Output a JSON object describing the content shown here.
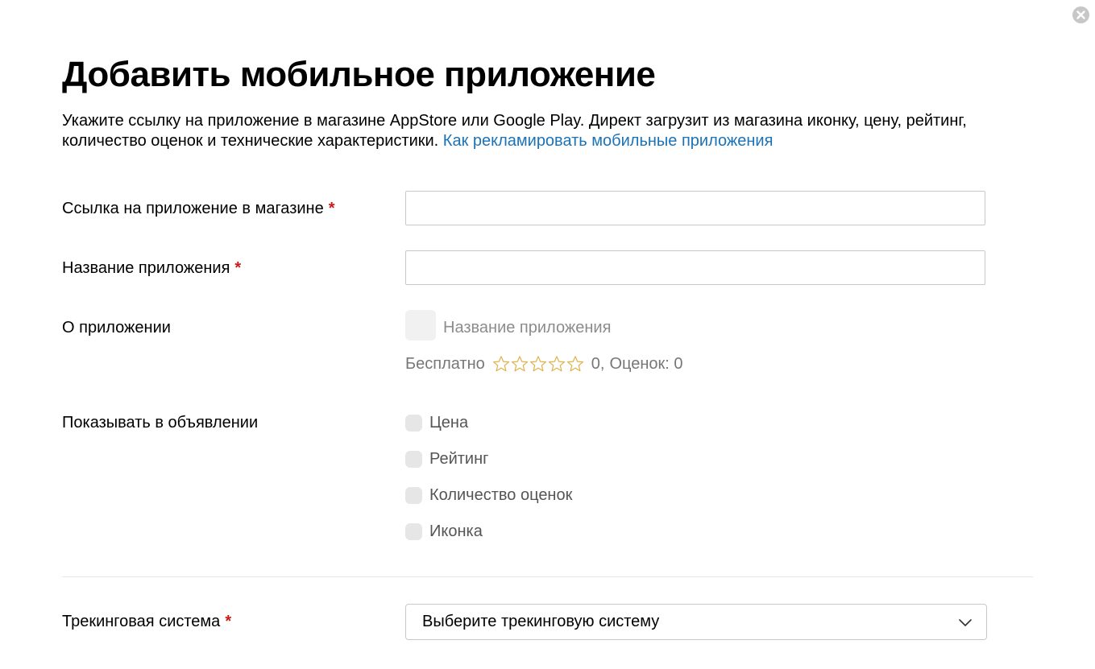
{
  "dialog": {
    "title": "Добавить мобильное приложение",
    "description": "Укажите ссылку на приложение в магазине AppStore или Google Play. Директ загрузит из магазина иконку, цену, рейтинг, количество оценок и технические характеристики. ",
    "help_link": "Как рекламировать мобильные приложения",
    "close_icon": "close-icon"
  },
  "form": {
    "store_link": {
      "label": "Ссылка на приложение в магазине",
      "required_mark": "*",
      "value": ""
    },
    "app_name": {
      "label": "Название приложения",
      "required_mark": "*",
      "value": ""
    },
    "about": {
      "label": "О приложении",
      "preview_name": "Название приложения",
      "price": "Бесплатно",
      "rating_value": "0,",
      "ratings_count": "Оценок: 0",
      "stars_filled": 0,
      "stars_total": 5,
      "star_color": "#e0b24a"
    },
    "show_in_ad": {
      "label": "Показывать в объявлении",
      "options": [
        {
          "label": "Цена",
          "checked": false
        },
        {
          "label": "Рейтинг",
          "checked": false
        },
        {
          "label": "Количество оценок",
          "checked": false
        },
        {
          "label": "Иконка",
          "checked": false
        }
      ]
    },
    "tracking": {
      "label": "Трекинговая система",
      "required_mark": "*",
      "selected": "Выберите трекинговую систему"
    }
  },
  "colors": {
    "link": "#1a73b8",
    "required": "#cc1a1a"
  }
}
